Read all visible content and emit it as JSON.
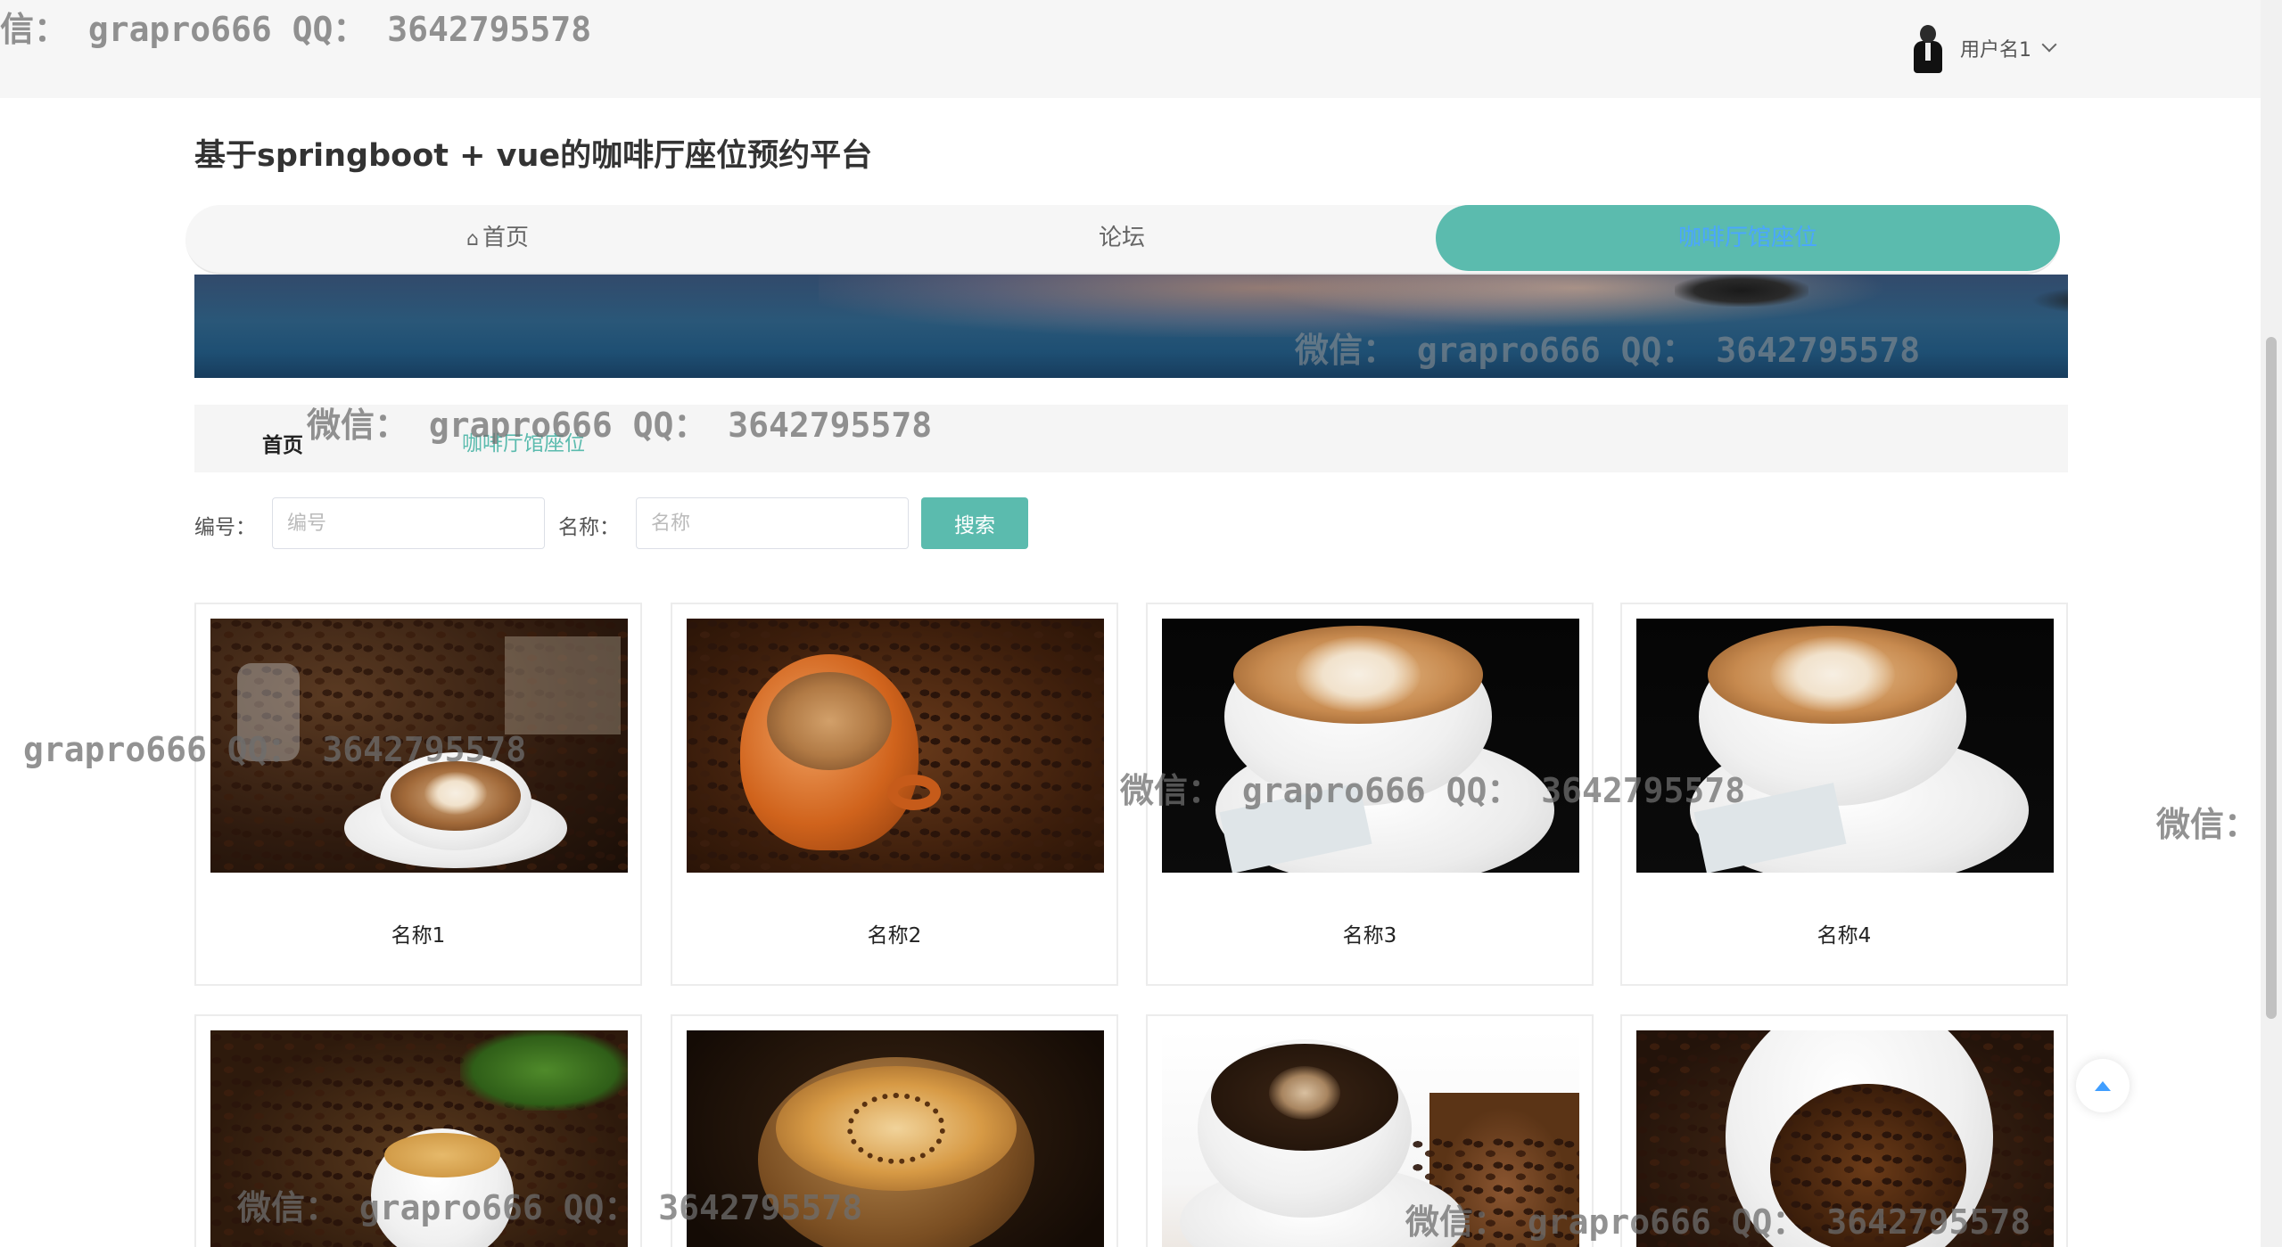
{
  "header": {
    "username": "用户名1"
  },
  "site_title": "基于springboot + vue的咖啡厅座位预约平台",
  "nav": {
    "items": [
      {
        "label": "首页",
        "icon": "home-icon"
      },
      {
        "label": "论坛"
      },
      {
        "label": "咖啡厅馆座位",
        "active": true
      }
    ]
  },
  "breadcrumb": {
    "home": "首页",
    "current": "咖啡厅馆座位"
  },
  "search": {
    "id_label": "编号：",
    "id_placeholder": "编号",
    "name_label": "名称：",
    "name_placeholder": "名称",
    "button": "搜索"
  },
  "cards": [
    {
      "name": "名称1"
    },
    {
      "name": "名称2"
    },
    {
      "name": "名称3"
    },
    {
      "name": "名称4"
    },
    {
      "name": ""
    },
    {
      "name": ""
    },
    {
      "name": ""
    },
    {
      "name": ""
    }
  ],
  "watermarks": {
    "top": "信： grapro666 QQ： 3642795578",
    "banner": "微信： grapro666 QQ： 3642795578",
    "crumb": "微信： grapro666 QQ： 3642795578",
    "left": "grapro666 QQ： 3642795578",
    "mid": "微信： grapro666 QQ： 3642795578",
    "right": "微信：",
    "bottom_left": "微信： grapro666 QQ： 3642795578",
    "bottom_right": "微信： grapro666 QQ： 3642795578"
  },
  "colors": {
    "accent": "#5bbbae",
    "active_nav_text": "#4aa6ff",
    "back_to_top_arrow": "#409eff"
  }
}
